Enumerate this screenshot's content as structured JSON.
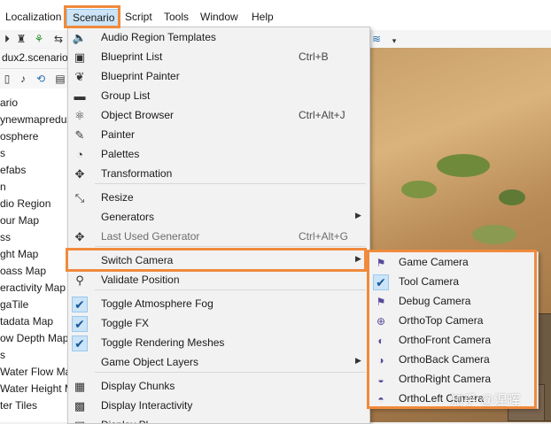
{
  "menubar": {
    "items": [
      "Localization",
      "Scenario",
      "Script",
      "Tools",
      "Window",
      "Help"
    ],
    "active": "Scenario"
  },
  "left_panel": {
    "file_name": "dux2.scenario",
    "tree_items": [
      "ario",
      "ynewmapredux",
      "osphere",
      "s",
      "efabs",
      "n",
      "dio Region",
      "our Map",
      "ss",
      "ght Map",
      "oass Map",
      "eractivity Map",
      "gaTile",
      "tadata Map",
      "ow Depth Map",
      "s",
      "Water Flow Ma",
      "Water Height M",
      "ter Tiles"
    ]
  },
  "scenario_menu": {
    "items": [
      {
        "label": "Audio Region Templates",
        "shortcut": "",
        "icon": "speaker-icon"
      },
      {
        "label": "Blueprint List",
        "shortcut": "Ctrl+B",
        "icon": "blueprint-icon"
      },
      {
        "label": "Blueprint Painter",
        "shortcut": "",
        "icon": "leaf-icon"
      },
      {
        "label": "Group List",
        "shortcut": "",
        "icon": "group-icon"
      },
      {
        "label": "Object Browser",
        "shortcut": "Ctrl+Alt+J",
        "icon": "object-browser-icon"
      },
      {
        "label": "Painter",
        "shortcut": "",
        "icon": "brush-icon"
      },
      {
        "label": "Palettes",
        "shortcut": "",
        "icon": "palette-icon"
      },
      {
        "label": "Transformation",
        "shortcut": "",
        "icon": "move-icon"
      },
      {
        "label": "Resize",
        "shortcut": "",
        "icon": "resize-icon"
      },
      {
        "label": "Generators",
        "shortcut": "",
        "icon": "",
        "submenu": true
      },
      {
        "label": "Last Used Generator",
        "shortcut": "Ctrl+Alt+G",
        "icon": "generator-icon",
        "disabled": true
      },
      {
        "label": "Switch Camera",
        "shortcut": "",
        "icon": "",
        "submenu": true
      },
      {
        "label": "Validate Position",
        "shortcut": "",
        "icon": "validate-icon"
      },
      {
        "label": "Toggle Atmosphere Fog",
        "shortcut": "",
        "icon": "checkmark-icon",
        "checked": true
      },
      {
        "label": "Toggle FX",
        "shortcut": "",
        "icon": "checkmark-icon",
        "checked": true
      },
      {
        "label": "Toggle Rendering Meshes",
        "shortcut": "",
        "icon": "checkmark-icon",
        "checked": true
      },
      {
        "label": "Game Object Layers",
        "shortcut": "",
        "icon": "",
        "submenu": true
      },
      {
        "label": "Display Chunks",
        "shortcut": "",
        "icon": "grid-icon"
      },
      {
        "label": "Display Interactivity",
        "shortcut": "",
        "icon": "interactivity-icon"
      },
      {
        "label": "Display Pl...",
        "shortcut": "",
        "icon": "display-icon"
      }
    ]
  },
  "switch_camera_submenu": {
    "items": [
      {
        "label": "Game Camera",
        "icon": "game-camera-icon"
      },
      {
        "label": "Tool Camera",
        "icon": "checkmark-icon",
        "checked": true
      },
      {
        "label": "Debug Camera",
        "icon": "debug-camera-icon"
      },
      {
        "label": "OrthoTop Camera",
        "icon": "orthotop-icon"
      },
      {
        "label": "OrthoFront Camera",
        "icon": "orthofront-icon"
      },
      {
        "label": "OrthoBack Camera",
        "icon": "orthoback-icon"
      },
      {
        "label": "OrthoRight Camera",
        "icon": "orthoright-icon"
      },
      {
        "label": "OrthoLeft Camera",
        "icon": "ortholeft-icon"
      }
    ]
  },
  "watermark": "知乎 @涅晖",
  "colors": {
    "highlight": "#f08a3c",
    "menu_bg": "#f2f2f2",
    "check_bg": "#cce4f7"
  }
}
